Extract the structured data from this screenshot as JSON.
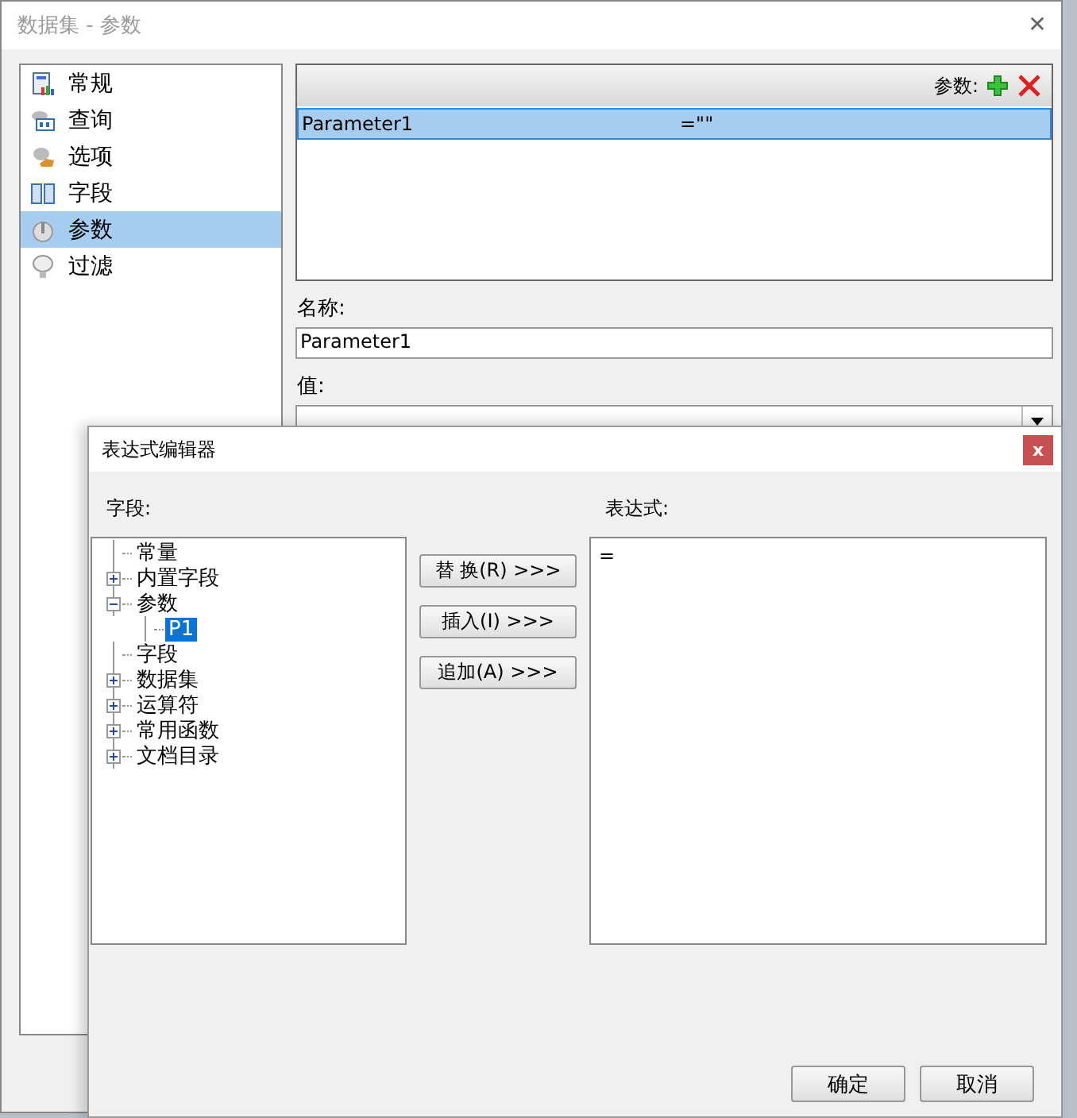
{
  "window": {
    "title": "数据集 - 参数",
    "close": "✕"
  },
  "sidebar": {
    "items": [
      {
        "label": "常规",
        "selected": false
      },
      {
        "label": "查询",
        "selected": false
      },
      {
        "label": "选项",
        "selected": false
      },
      {
        "label": "字段",
        "selected": false
      },
      {
        "label": "参数",
        "selected": true
      },
      {
        "label": "过滤",
        "selected": false
      }
    ]
  },
  "parameters": {
    "header_label": "参数:",
    "rows": [
      {
        "name": "Parameter1",
        "value": "=\"\"",
        "selected": true
      }
    ]
  },
  "name_field": {
    "label": "名称:",
    "value": "Parameter1"
  },
  "value_field": {
    "label": "值:"
  },
  "dialog": {
    "title": "表达式编辑器",
    "close": "x",
    "fields_label": "字段:",
    "tree": [
      {
        "label": "常量",
        "selected": false
      },
      {
        "label": "内置字段",
        "expanded": false,
        "selected": false
      },
      {
        "label": "参数",
        "expanded": true,
        "selected": false,
        "children": [
          {
            "label": "P1",
            "selected": true
          }
        ]
      },
      {
        "label": "字段",
        "selected": false
      },
      {
        "label": "数据集",
        "expanded": false,
        "selected": false
      },
      {
        "label": "运算符",
        "expanded": false,
        "selected": false
      },
      {
        "label": "常用函数",
        "expanded": false,
        "selected": false
      },
      {
        "label": "文档目录",
        "expanded": false,
        "selected": false
      }
    ],
    "actions": [
      "替 换(R) >>>",
      "插入(I) >>>",
      "追加(A) >>>"
    ],
    "expression_label": "表达式:",
    "expression": "=",
    "buttons": [
      "确定",
      "取消"
    ]
  }
}
